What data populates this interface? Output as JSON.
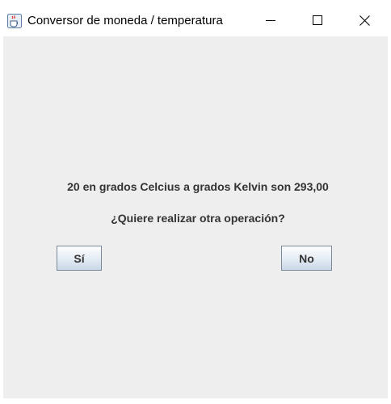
{
  "window": {
    "title": "Conversor de moneda / temperatura",
    "app_icon": "java-cup-icon",
    "controls": {
      "minimize_icon": "minimize-icon",
      "maximize_icon": "maximize-icon",
      "close_icon": "close-icon"
    }
  },
  "dialog": {
    "result_message": "20 en grados Celcius a grados Kelvin son 293,00",
    "question": "¿Quiere realizar otra operación?",
    "yes_label": "Sí",
    "no_label": "No"
  },
  "colors": {
    "content_background": "#eeeeee",
    "text": "#333333",
    "button_border": "#7a8a99"
  }
}
